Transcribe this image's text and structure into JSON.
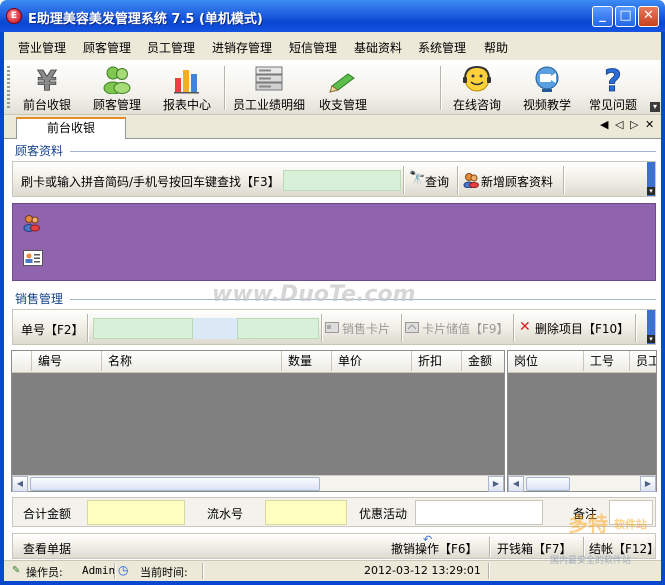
{
  "window": {
    "title": "E助理美容美发管理系统 7.5 (单机模式)",
    "icon_letter": "E",
    "minimize": "_",
    "maximize": "□",
    "close": "✕"
  },
  "menu": [
    "营业管理",
    "顾客管理",
    "员工管理",
    "进销存管理",
    "短信管理",
    "基础资料",
    "系统管理",
    "帮助"
  ],
  "toolbar": {
    "items": [
      {
        "label": "前台收银",
        "icon": "yen-icon"
      },
      {
        "label": "顾客管理",
        "icon": "customers-icon"
      },
      {
        "label": "报表中心",
        "icon": "bar-chart-icon"
      },
      {
        "label": "员工业绩明细",
        "icon": "item-list-icon"
      },
      {
        "label": "收支管理",
        "icon": "pen-icon"
      },
      {
        "label": "在线咨询",
        "icon": "smiley-headset-icon"
      },
      {
        "label": "视频教学",
        "icon": "video-camera-icon"
      },
      {
        "label": "常见问题",
        "icon": "question-icon"
      }
    ]
  },
  "tabs": {
    "active": "前台收银",
    "nav": [
      "◀",
      "◁",
      "▷",
      "✕"
    ]
  },
  "customer_section": {
    "title": "顾客资料",
    "search_label": "刷卡或输入拼音简码/手机号按回车键查找【F3】",
    "search_value": "",
    "query_button": "查询",
    "add_button": "新增顾客资料",
    "panel_color": "#8f63ae"
  },
  "sales_section": {
    "title": "销售管理",
    "order_label": "单号【F2】",
    "sell_card": "销售卡片",
    "card_recharge": "卡片储值【F9】",
    "delete_item": "删除项目【F10】",
    "left_columns": [
      "编号",
      "名称",
      "数量",
      "单价",
      "折扣",
      "金额"
    ],
    "right_columns": [
      "岗位",
      "工号",
      "员工"
    ]
  },
  "totals": {
    "total_label": "合计金额",
    "serial_label": "流水号",
    "promo_label": "优惠活动",
    "remark_label": "备注"
  },
  "actions": {
    "view_orders": "查看单据",
    "undo": "撤销操作【F6】",
    "open_drawer": "开钱箱【F7】",
    "checkout": "结帐【F12】"
  },
  "status": {
    "operator_label": "操作员:",
    "operator": "Admin",
    "time_label": "当前时间:",
    "datetime": "2012-03-12 13:29:01"
  },
  "watermarks": {
    "center": "www.DuoTe.com",
    "logo_main": "多特",
    "logo_side": "软件站",
    "logo_sub": "国内最安全的软件站"
  }
}
